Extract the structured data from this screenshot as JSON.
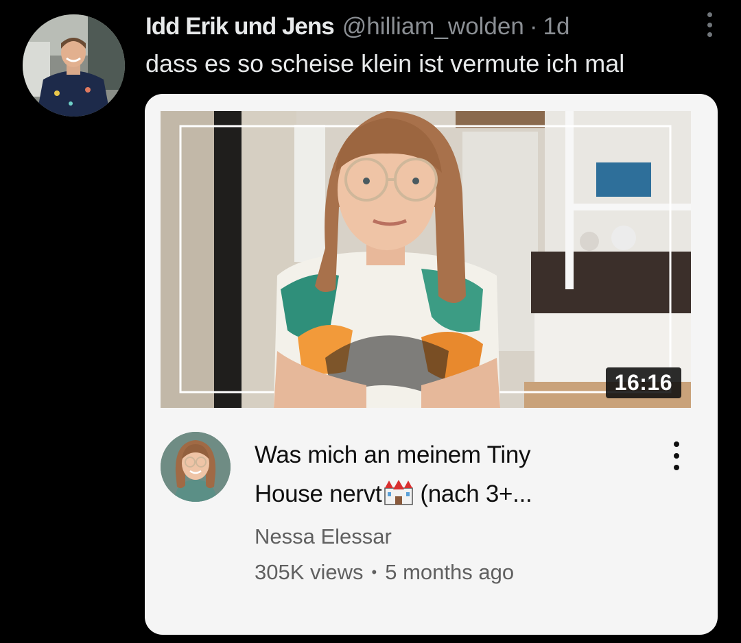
{
  "tweet": {
    "author_name": "Idd Erik und Jens",
    "handle": "@hilliam_wolden",
    "separator": "·",
    "time": "1d",
    "text": "dass es so scheise klein ist vermute ich mal"
  },
  "video_card": {
    "duration": "16:16",
    "title_line1": "Was mich an meinem Tiny",
    "title_line2_start": "House nervt",
    "title_line2_end": "(nach 3+...",
    "title_emoji_icon": "castle-icon",
    "channel_name": "Nessa Elessar",
    "views": "305K views",
    "meta_separator": "•",
    "age": "5 months ago"
  },
  "colors": {
    "background": "#000000",
    "tweet_text": "#e7e9ea",
    "secondary_text": "#8b8f94",
    "card_background": "#f5f5f5",
    "card_secondary_text": "#606060"
  }
}
